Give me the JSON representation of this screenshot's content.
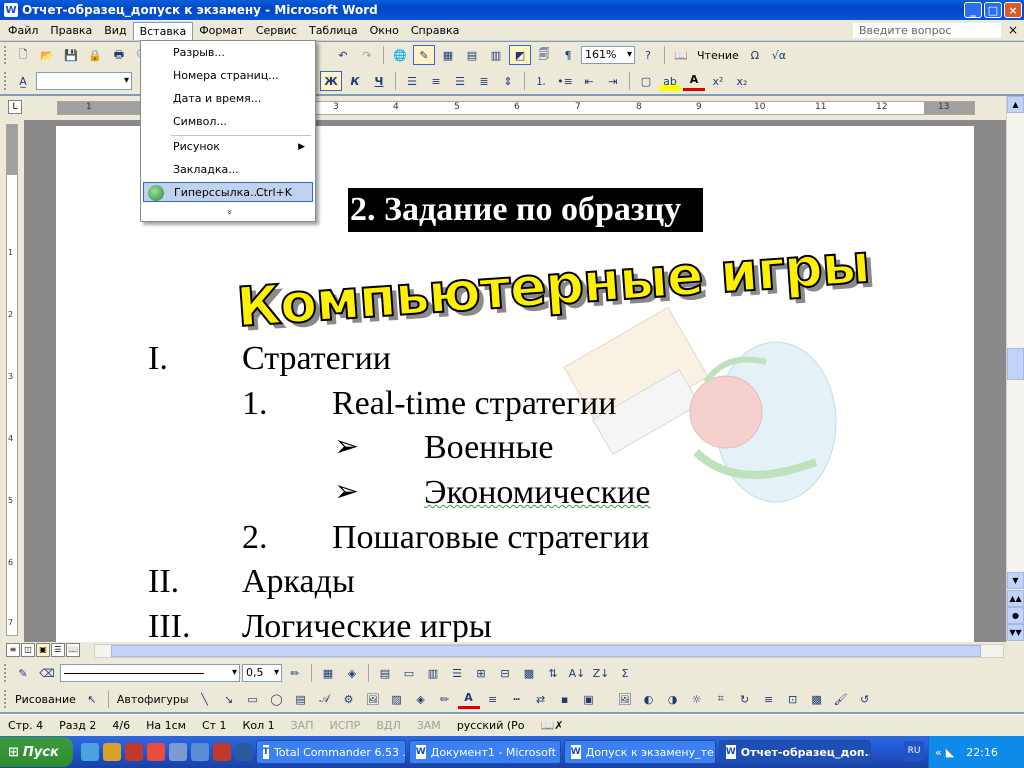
{
  "window": {
    "title": "Отчет-образец_допуск к экзамену - Microsoft Word",
    "app_icon": "W",
    "buttons": [
      "_",
      "□",
      "×"
    ]
  },
  "menubar": {
    "items": [
      "Файл",
      "Правка",
      "Вид",
      "Вставка",
      "Формат",
      "Сервис",
      "Таблица",
      "Окно",
      "Справка"
    ],
    "active": "Вставка",
    "help_placeholder": "Введите вопрос"
  },
  "toolbar_standard": {
    "zoom": "161%",
    "reading": "Чтение"
  },
  "toolbar_format": {
    "style_value": "",
    "bold_label": "Ж",
    "italic_label": "К",
    "underline_label": "Ч"
  },
  "ruler_numbers": [
    "1",
    "1",
    "2",
    "3",
    "4",
    "5",
    "6",
    "7",
    "8",
    "9",
    "10",
    "11",
    "12",
    "13"
  ],
  "vruler_numbers": [
    "1",
    "2",
    "3",
    "4",
    "5",
    "6",
    "7"
  ],
  "insert_menu": {
    "items": [
      {
        "label": "Разрыв..."
      },
      {
        "label": "Номера страниц..."
      },
      {
        "label": "Дата и время..."
      },
      {
        "label": "Символ..."
      },
      {
        "label": "Рисунок",
        "submenu": true
      },
      {
        "label": "Закладка..."
      },
      {
        "label": "Гиперссылка...",
        "shortcut": "Ctrl+K",
        "highlighted": true
      }
    ],
    "expand": "»"
  },
  "document": {
    "heading": "2. Задание по образцу",
    "wordart": "Компьютерные игры",
    "list": [
      {
        "marker": "I.",
        "text": "Стратегии"
      },
      {
        "marker": "1.",
        "text": "Real-time стратегии"
      },
      {
        "marker": "➢",
        "text": "Военные"
      },
      {
        "marker": "➢",
        "text": "Экономические"
      },
      {
        "marker": "2.",
        "text": "Пошаговые стратегии"
      },
      {
        "marker": "II.",
        "text": "Аркады"
      },
      {
        "marker": "III.",
        "text": "Логические игры"
      }
    ]
  },
  "toolbar_drawing": {
    "line_width": "0,5",
    "drawing_label": "Рисование",
    "autoshapes_label": "Автофигуры"
  },
  "statusbar": {
    "page": "Стр. 4",
    "section": "Разд 2",
    "pages": "4/6",
    "at": "На 1см",
    "line": "Ст 1",
    "col": "Кол 1",
    "rec": "ЗАП",
    "trk": "ИСПР",
    "ext": "ВДЛ",
    "ovr": "ЗАМ",
    "lang": "русский (Ро"
  },
  "taskbar": {
    "start": "Пуск",
    "tasks": [
      {
        "label": "Total Commander 6.53 ...",
        "active": false
      },
      {
        "label": "Документ1 - Microsoft ...",
        "active": false
      },
      {
        "label": "Допуск к экзамену_те...",
        "active": false
      },
      {
        "label": "Отчет-образец_доп...",
        "active": true
      }
    ],
    "lang": "RU",
    "time": "22:16"
  },
  "colors": {
    "wordart_fill": "#ffef00",
    "heading_bg": "#000000",
    "menu_highlight": "#c1d2ee"
  }
}
